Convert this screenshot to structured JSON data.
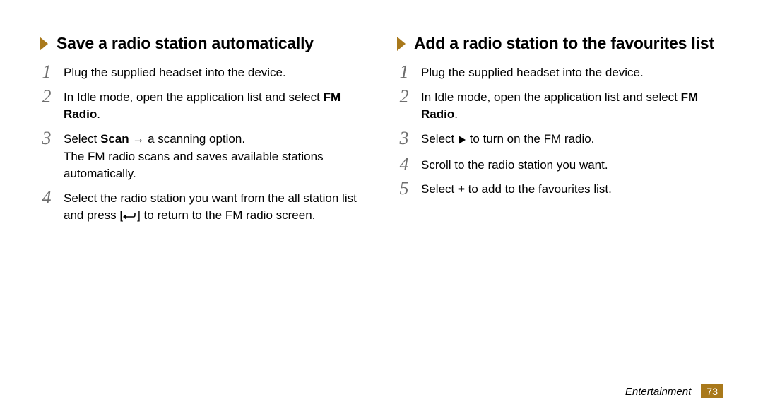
{
  "left": {
    "heading": "Save a radio station automatically",
    "steps": [
      {
        "num": "1",
        "text": "Plug the supplied headset into the device."
      },
      {
        "num": "2",
        "pre": "In Idle mode, open the application list and select ",
        "bold": "FM Radio",
        "post": "."
      },
      {
        "num": "3",
        "pre": "Select ",
        "bold": "Scan",
        "post": " → a scanning option.",
        "sub": "The FM radio scans and saves available stations automatically."
      },
      {
        "num": "4",
        "text": "Select the radio station you want from the all station list and press [",
        "icon": "return-icon",
        "text2": "] to return to the FM radio screen."
      }
    ]
  },
  "right": {
    "heading": "Add a radio station to the favourites list",
    "steps": [
      {
        "num": "1",
        "text": "Plug the supplied headset into the device."
      },
      {
        "num": "2",
        "pre": "In Idle mode, open the application list and select ",
        "bold": "FM Radio",
        "post": "."
      },
      {
        "num": "3",
        "pre": "Select ",
        "icon": "play-icon",
        "post": " to turn on the FM radio."
      },
      {
        "num": "4",
        "text": "Scroll to the radio station you want."
      },
      {
        "num": "5",
        "pre": "Select ",
        "bold": "+",
        "post": " to add to the favourites list."
      }
    ]
  },
  "footer": {
    "category": "Entertainment",
    "page": "73"
  }
}
